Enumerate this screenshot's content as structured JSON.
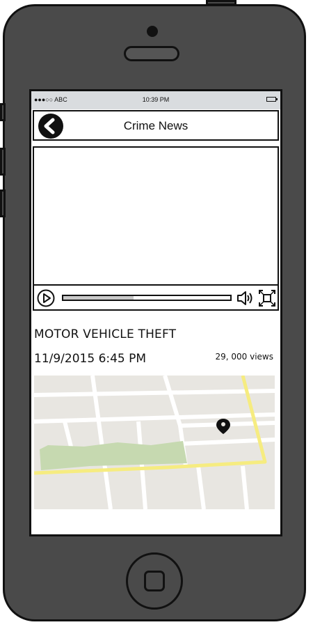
{
  "status_bar": {
    "carrier": "●●●○○ ABC",
    "time": "10:39 PM",
    "battery_icon": "battery-icon"
  },
  "nav": {
    "title": "Crime News",
    "back_icon": "back-arrow-icon"
  },
  "video_player": {
    "progress_fraction": 0.42,
    "play_icon": "play-icon",
    "volume_icon": "volume-icon",
    "fullscreen_icon": "fullscreen-icon"
  },
  "article": {
    "headline": "MOTOR VEHICLE THEFT",
    "datetime": "11/9/2015 6:45 PM",
    "views": "29, 000 views"
  },
  "map": {
    "marker_icon": "map-pin-icon",
    "colors": {
      "land": "#e8e6e1",
      "road": "#ffffff",
      "highway": "#f6ec80",
      "park": "#c6d9b0",
      "marker": "#111111"
    }
  },
  "device": {
    "body_color": "#4a4a4a",
    "outline_color": "#111111"
  }
}
